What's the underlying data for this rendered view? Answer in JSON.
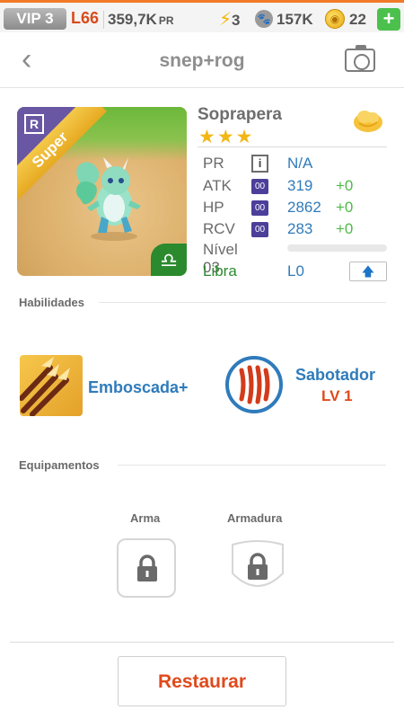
{
  "status_bar": {
    "vip": "VIP 3",
    "level": "L66",
    "power_value": "359,7K",
    "power_label": "PR",
    "energy": "3",
    "food": "157K",
    "coins": "22",
    "add_label": "+"
  },
  "nav": {
    "back_icon": "chevron-left-icon",
    "title": "snep+rog",
    "camera_icon": "camera-icon"
  },
  "portrait": {
    "rarity": "R",
    "ribbon": "Super",
    "zodiac_symbol": "♎"
  },
  "monster": {
    "name": "Soprapera",
    "stars": "★★★",
    "stats": [
      {
        "label": "PR",
        "badge": "i",
        "value": "N/A",
        "bonus": ""
      },
      {
        "label": "ATK",
        "badge": "00",
        "value": "319",
        "bonus": "+0"
      },
      {
        "label": "HP",
        "badge": "00",
        "value": "2862",
        "bonus": "+0"
      },
      {
        "label": "RCV",
        "badge": "00",
        "value": "283",
        "bonus": "+0"
      }
    ],
    "level_label": "Nível 03",
    "level_progress": 0,
    "zodiac": "Libra",
    "zodiac_level": "L0"
  },
  "abilities": {
    "title": "Habilidades",
    "skill1": {
      "name": "Emboscada+"
    },
    "skill2": {
      "name": "Sabotador",
      "level": "LV 1"
    }
  },
  "equipment": {
    "title": "Equipamentos",
    "weapon_label": "Arma",
    "armor_label": "Armadura"
  },
  "footer": {
    "restore_label": "Restaurar"
  },
  "colors": {
    "accent_orange": "#e04a1c",
    "link_blue": "#2f7bbb",
    "bonus_green": "#4fba47",
    "libra_green": "#2a8b2c"
  }
}
